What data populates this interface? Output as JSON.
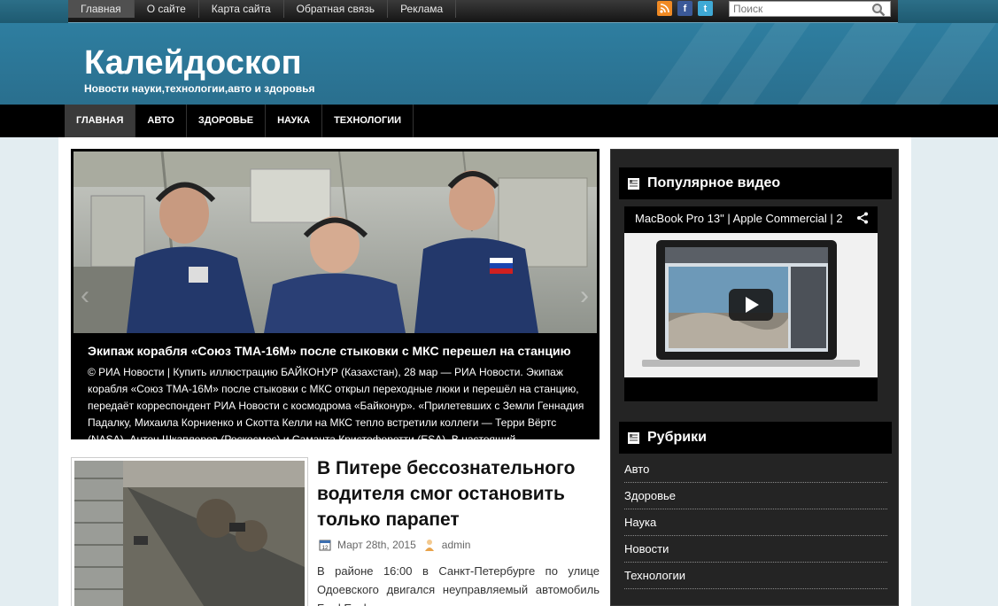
{
  "topbar": {
    "nav": [
      "Главная",
      "О сайте",
      "Карта сайта",
      "Обратная связь",
      "Реклама"
    ],
    "search_placeholder": "Поиск",
    "social": [
      "rss-icon",
      "facebook-icon",
      "twitter-icon"
    ]
  },
  "header": {
    "title": "Калейдоскоп",
    "description": "Новости науки,технологии,авто и здоровья"
  },
  "mainnav": [
    "ГЛАВНАЯ",
    "АВТО",
    "ЗДОРОВЬЕ",
    "НАУКА",
    "ТЕХНОЛОГИИ"
  ],
  "slider": {
    "title": "Экипаж корабля «Союз ТМА-16М» после стыковки с МКС перешел на станцию",
    "text": "© РИА Новости | Купить иллюстрацию БАЙКОНУР (Казахстан), 28 мар — РИА Новости. Экипаж корабля «Союз ТМА-16М» после стыковки с МКС открыл переходные люки и перешёл на станцию, передаёт корреспондент РИА Новости с космодрома «Байконур». «Прилетевших с Земли Геннадия Падалку, Михаила Корниенко и Скотта Келли на МКС тепло встретили коллеги — Терри Вёртс (NASA), Антон Шкаплеров (Роскосмос) и Саманта Кристофоретти (ESA). В настоящий"
  },
  "post": {
    "title": "В Питере бессознательного водителя смог остановить только парапет",
    "date": "Март 28th, 2015",
    "author": "admin",
    "excerpt": "В районе 16:00 в Санкт-Петербурге по улице Одоевского двигался неуправляемый автомобиль Ford Explorer под управлением"
  },
  "sidebar": {
    "video_widget_title": "Популярное видео",
    "video_title": "MacBook Pro 13\" | Apple Commercial | 2",
    "categories_title": "Рубрики",
    "categories": [
      "Авто",
      "Здоровье",
      "Наука",
      "Новости",
      "Технологии"
    ]
  },
  "colors": {
    "header_bg": "#2e7ea0",
    "nav_bg": "#000000",
    "sidebar_bg": "#242424",
    "page_bg": "#e3edf1"
  }
}
